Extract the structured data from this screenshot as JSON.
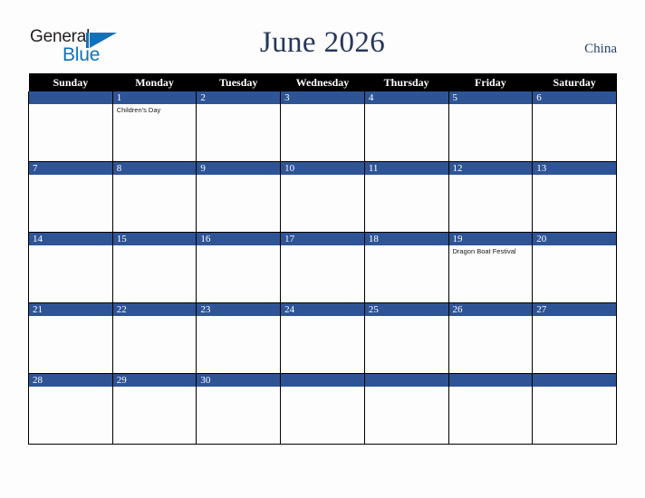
{
  "brand": {
    "name_part1": "General",
    "name_part2": "Blue",
    "mark_icon": "triangle-logo-icon",
    "accent_color": "#1272b8"
  },
  "header": {
    "title": "June 2026",
    "country": "China",
    "title_color": "#27375c"
  },
  "calendar": {
    "weekday_headers": [
      "Sunday",
      "Monday",
      "Tuesday",
      "Wednesday",
      "Thursday",
      "Friday",
      "Saturday"
    ],
    "header_background": "#000000",
    "daybar_background": "#2e5496",
    "weeks": [
      [
        {
          "day": "",
          "events": []
        },
        {
          "day": "1",
          "events": [
            "Children's Day"
          ]
        },
        {
          "day": "2",
          "events": []
        },
        {
          "day": "3",
          "events": []
        },
        {
          "day": "4",
          "events": []
        },
        {
          "day": "5",
          "events": []
        },
        {
          "day": "6",
          "events": []
        }
      ],
      [
        {
          "day": "7",
          "events": []
        },
        {
          "day": "8",
          "events": []
        },
        {
          "day": "9",
          "events": []
        },
        {
          "day": "10",
          "events": []
        },
        {
          "day": "11",
          "events": []
        },
        {
          "day": "12",
          "events": []
        },
        {
          "day": "13",
          "events": []
        }
      ],
      [
        {
          "day": "14",
          "events": []
        },
        {
          "day": "15",
          "events": []
        },
        {
          "day": "16",
          "events": []
        },
        {
          "day": "17",
          "events": []
        },
        {
          "day": "18",
          "events": []
        },
        {
          "day": "19",
          "events": [
            "Dragon Boat Festival"
          ]
        },
        {
          "day": "20",
          "events": []
        }
      ],
      [
        {
          "day": "21",
          "events": []
        },
        {
          "day": "22",
          "events": []
        },
        {
          "day": "23",
          "events": []
        },
        {
          "day": "24",
          "events": []
        },
        {
          "day": "25",
          "events": []
        },
        {
          "day": "26",
          "events": []
        },
        {
          "day": "27",
          "events": []
        }
      ],
      [
        {
          "day": "28",
          "events": []
        },
        {
          "day": "29",
          "events": []
        },
        {
          "day": "30",
          "events": []
        },
        {
          "day": "",
          "events": []
        },
        {
          "day": "",
          "events": []
        },
        {
          "day": "",
          "events": []
        },
        {
          "day": "",
          "events": []
        }
      ]
    ]
  }
}
